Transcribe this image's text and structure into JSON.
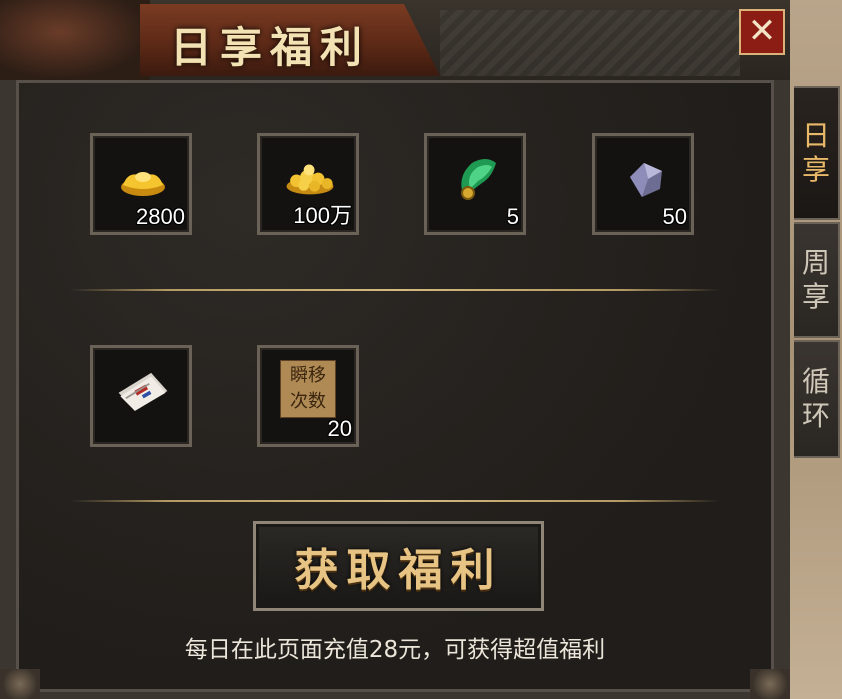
{
  "window": {
    "title": "日享福利",
    "close_label": "✕"
  },
  "tabs": [
    {
      "label_top": "日",
      "label_bottom": "享",
      "active": true
    },
    {
      "label_top": "周",
      "label_bottom": "享",
      "active": false
    },
    {
      "label_top": "循",
      "label_bottom": "环",
      "active": false
    }
  ],
  "rewards": [
    {
      "icon": "gold-ingot-icon",
      "qty": "2800"
    },
    {
      "icon": "gold-coins-icon",
      "qty": "100万"
    },
    {
      "icon": "green-jade-icon",
      "qty": "5"
    },
    {
      "icon": "purple-gem-icon",
      "qty": "50"
    },
    {
      "icon": "scroll-book-icon",
      "qty": ""
    },
    {
      "icon": "teleport-count-icon",
      "qty": "20",
      "label_line1": "瞬移",
      "label_line2": "次数"
    }
  ],
  "claim_button": {
    "label": "获取福利"
  },
  "hint": {
    "text": "每日在此页面充值28元，可获得超值福利"
  },
  "colors": {
    "accent_gold": "#e7c483",
    "close_red": "#8c1d14",
    "tab_active": "#e8b969"
  }
}
